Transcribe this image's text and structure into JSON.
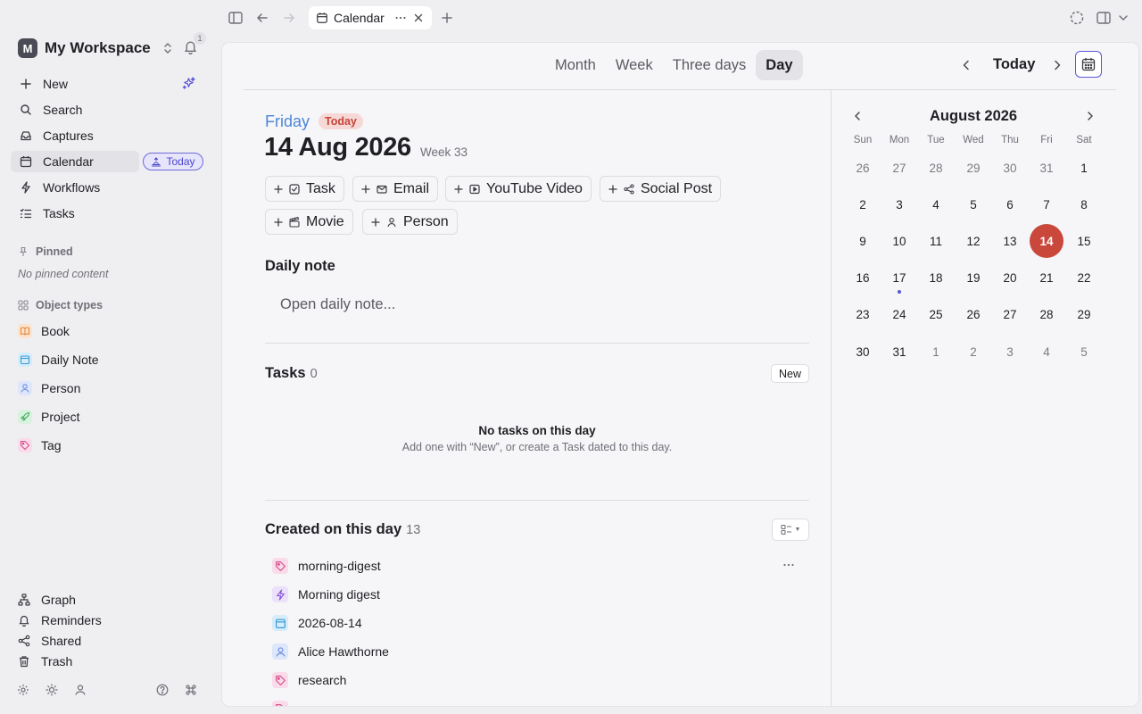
{
  "tab": {
    "title": "Calendar"
  },
  "sidebar": {
    "workspace": {
      "initial": "M",
      "name": "My Workspace",
      "notifications": "1"
    },
    "nav": [
      {
        "label": "New",
        "icon": "plus-icon"
      },
      {
        "label": "Search",
        "icon": "search-icon"
      },
      {
        "label": "Captures",
        "icon": "inbox-icon"
      },
      {
        "label": "Calendar",
        "icon": "calendar-icon",
        "active": true
      },
      {
        "label": "Workflows",
        "icon": "bolt-icon"
      },
      {
        "label": "Tasks",
        "icon": "task-list-icon"
      }
    ],
    "today_pill": "Today",
    "pinned": {
      "label": "Pinned",
      "empty": "No pinned content"
    },
    "object_types": {
      "label": "Object types",
      "items": [
        {
          "label": "Book",
          "icon": "book-icon",
          "color": "#e58a3a",
          "bg": "#fbe3cf"
        },
        {
          "label": "Daily Note",
          "icon": "calendar-icon",
          "color": "#3b9bd6",
          "bg": "#d6ecfa"
        },
        {
          "label": "Person",
          "icon": "person-icon",
          "color": "#6c8fe0",
          "bg": "#dde6fb"
        },
        {
          "label": "Project",
          "icon": "rocket-icon",
          "color": "#3fae5f",
          "bg": "#d8f2df"
        },
        {
          "label": "Tag",
          "icon": "tag-icon",
          "color": "#d6508e",
          "bg": "#f9dbe9"
        }
      ]
    },
    "bottom": [
      {
        "label": "Graph",
        "icon": "graph-icon"
      },
      {
        "label": "Reminders",
        "icon": "bell-icon"
      },
      {
        "label": "Shared",
        "icon": "share-icon"
      },
      {
        "label": "Trash",
        "icon": "trash-icon"
      }
    ]
  },
  "views": [
    "Month",
    "Week",
    "Three days",
    "Day"
  ],
  "active_view": "Day",
  "today_label": "Today",
  "day": {
    "weekday": "Friday",
    "badge": "Today",
    "date": "14 Aug 2026",
    "week": "Week 33",
    "quick_add": [
      {
        "label": "Task",
        "icon": "checkbox-icon"
      },
      {
        "label": "Email",
        "icon": "mail-icon"
      },
      {
        "label": "YouTube Video",
        "icon": "video-icon"
      },
      {
        "label": "Social Post",
        "icon": "share-icon"
      },
      {
        "label": "Movie",
        "icon": "clapper-icon"
      },
      {
        "label": "Person",
        "icon": "person-icon"
      }
    ],
    "daily_note": {
      "title": "Daily note",
      "placeholder": "Open daily note..."
    },
    "tasks": {
      "title": "Tasks",
      "count": "0",
      "new_label": "New",
      "empty_title": "No tasks on this day",
      "empty_sub": "Add one with “New”, or create a Task dated to this day."
    },
    "created": {
      "title": "Created on this day",
      "count": "13",
      "items": [
        {
          "label": "morning-digest",
          "icon": "tag-icon",
          "color": "#d6508e",
          "bg": "#f9dbe9"
        },
        {
          "label": "Morning digest",
          "icon": "bolt-icon",
          "color": "#8a5ad6",
          "bg": "#ece1fb"
        },
        {
          "label": "2026-08-14",
          "icon": "calendar-icon",
          "color": "#3b9bd6",
          "bg": "#d6ecfa"
        },
        {
          "label": "Alice Hawthorne",
          "icon": "person-icon",
          "color": "#6c8fe0",
          "bg": "#dde6fb"
        },
        {
          "label": "research",
          "icon": "tag-icon",
          "color": "#d6508e",
          "bg": "#f9dbe9"
        },
        {
          "label": "",
          "icon": "tag-icon",
          "color": "#d6508e",
          "bg": "#f9dbe9"
        }
      ]
    }
  },
  "mini_calendar": {
    "title": "August 2026",
    "weekdays": [
      "Sun",
      "Mon",
      "Tue",
      "Wed",
      "Thu",
      "Fri",
      "Sat"
    ],
    "weeks": [
      [
        "26",
        "27",
        "28",
        "29",
        "30",
        "31",
        "1"
      ],
      [
        "2",
        "3",
        "4",
        "5",
        "6",
        "7",
        "8"
      ],
      [
        "9",
        "10",
        "11",
        "12",
        "13",
        "14",
        "15"
      ],
      [
        "16",
        "17",
        "18",
        "19",
        "20",
        "21",
        "22"
      ],
      [
        "23",
        "24",
        "25",
        "26",
        "27",
        "28",
        "29"
      ],
      [
        "30",
        "31",
        "1",
        "2",
        "3",
        "4",
        "5"
      ]
    ],
    "selected": "14",
    "dot_on": "17",
    "accent": "#c9473b"
  }
}
